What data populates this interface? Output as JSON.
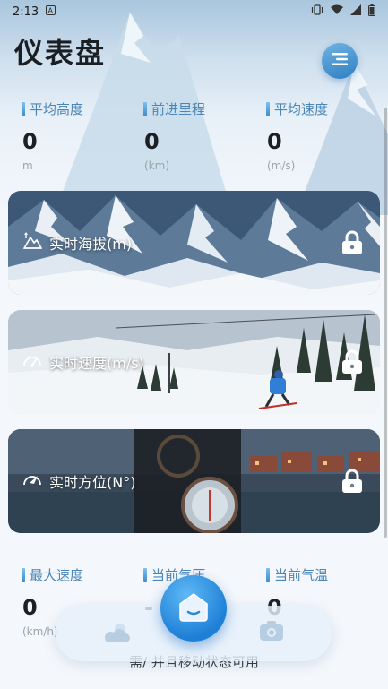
{
  "status_bar": {
    "time": "2:13",
    "icons": [
      "notification-a-icon",
      "vibrate-icon",
      "wifi-icon",
      "signal-icon",
      "battery-icon"
    ]
  },
  "header": {
    "title": "仪表盘",
    "menu_icon": "menu-lines-icon"
  },
  "top_stats": [
    {
      "label": "平均高度",
      "value": "0",
      "unit": "m"
    },
    {
      "label": "前进里程",
      "value": "0",
      "unit": "(km)"
    },
    {
      "label": "平均速度",
      "value": "0",
      "unit": "(m/s)"
    }
  ],
  "cards": [
    {
      "label": "实时海拔(m)",
      "icon": "mountain-icon",
      "locked": true
    },
    {
      "label": "实时速度(m/s)",
      "icon": "speedometer-icon",
      "locked": true
    },
    {
      "label": "实时方位(N°)",
      "icon": "compass-gauge-icon",
      "locked": true
    }
  ],
  "bottom_stats": [
    {
      "label": "最大速度",
      "value": "0",
      "unit": "(km/h)"
    },
    {
      "label": "当前气压",
      "value": "-",
      "unit": ""
    },
    {
      "label": "当前气温",
      "value": "0",
      "unit": ""
    }
  ],
  "bottom_nav": {
    "items": [
      "weather-icon",
      "home-icon",
      "camera-icon"
    ]
  },
  "hint": "需/ 并且移动状态可用",
  "colors": {
    "accent": "#2f7fc2",
    "label_blue": "#4a86b8"
  }
}
